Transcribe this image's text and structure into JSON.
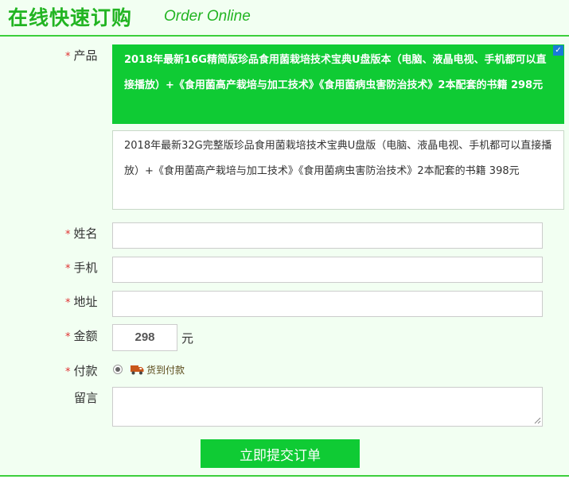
{
  "header": {
    "title_cn": "在线快速订购",
    "title_en": "Order Online"
  },
  "form": {
    "required_mark": "*",
    "product_label": "产品",
    "products": [
      {
        "text": "2018年最新16G精简版珍品食用菌栽培技术宝典U盘版本（电脑、液晶电视、手机都可以直接播放）+《食用菌高产栽培与加工技术》《食用菌病虫害防治技术》2本配套的书籍  298元",
        "selected": true
      },
      {
        "text": "2018年最新32G完整版珍品食用菌栽培技术宝典U盘版（电脑、液晶电视、手机都可以直接播放）+《食用菌高产栽培与加工技术》《食用菌病虫害防治技术》2本配套的书籍  398元",
        "selected": false
      }
    ],
    "selected_check": "✓",
    "name_label": "姓名",
    "name_value": "",
    "phone_label": "手机",
    "phone_value": "",
    "address_label": "地址",
    "address_value": "",
    "amount_label": "金额",
    "amount_value": "298",
    "amount_unit": "元",
    "payment_label": "付款",
    "payment_option": "货到付款",
    "payment_icon": "truck-icon",
    "message_label": "留言",
    "message_value": "",
    "submit_label": "立即提交订单"
  },
  "colors": {
    "accent": "#0fcb34",
    "title": "#22b422",
    "required": "#e03030"
  }
}
